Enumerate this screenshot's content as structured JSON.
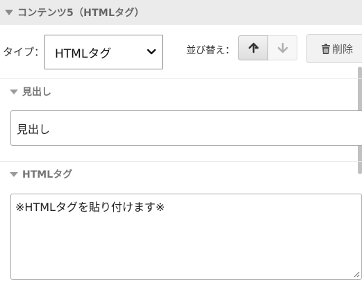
{
  "section": {
    "title": "コンテンツ5（HTMLタグ）"
  },
  "type_field": {
    "label": "タイプ：",
    "selected": "HTMLタグ"
  },
  "sort": {
    "label": "並び替え："
  },
  "delete_button": {
    "label": "削除"
  },
  "heading_field": {
    "label": "見出し",
    "value": "見出し"
  },
  "html_field": {
    "label": "HTMLタグ",
    "value": "※HTMLタグを貼り付けます※"
  },
  "icons": {
    "collapse": "triangle-down-icon",
    "select": "chevron-down-icon",
    "up": "arrow-up-icon",
    "down": "arrow-down-icon",
    "delete": "trash-icon",
    "resize": "resize-grip-icon"
  },
  "colors": {
    "header_bg": "#ebebeb",
    "border": "#a9a9a9"
  }
}
